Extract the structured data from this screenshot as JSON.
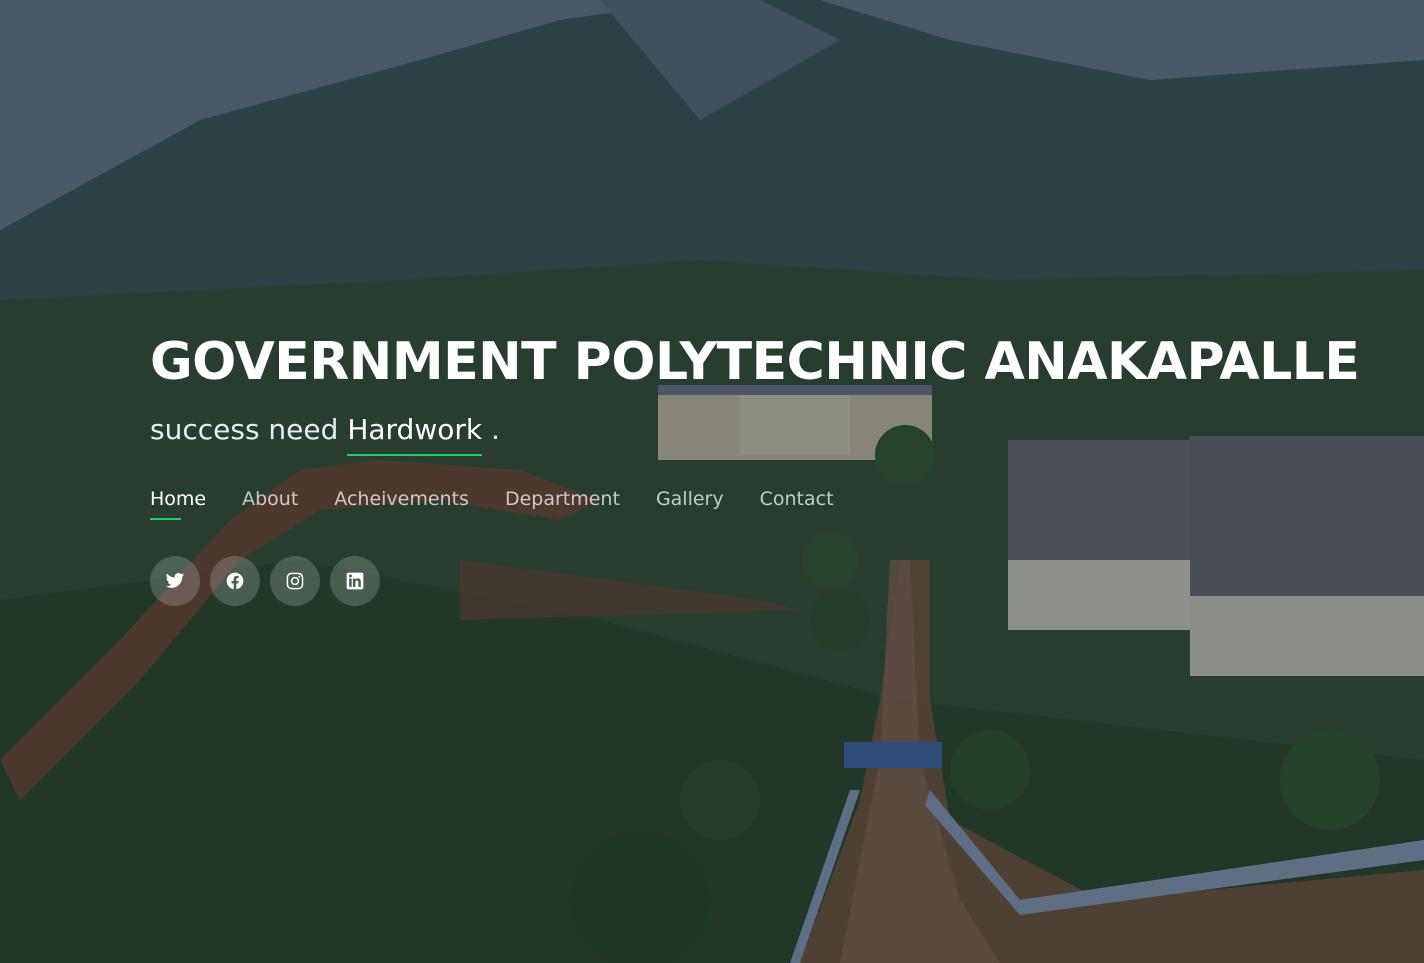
{
  "hero": {
    "title": "GOVERNMENT POLYTECHNIC ANAKAPALLE",
    "tagline_prefix": "success need ",
    "tagline_highlight": "Hardwork",
    "tagline_suffix": " ."
  },
  "nav": {
    "items": [
      {
        "label": "Home",
        "active": true
      },
      {
        "label": "About",
        "active": false
      },
      {
        "label": "Acheivements",
        "active": false
      },
      {
        "label": "Department",
        "active": false
      },
      {
        "label": "Gallery",
        "active": false
      },
      {
        "label": "Contact",
        "active": false
      }
    ]
  },
  "social": {
    "icons": [
      "twitter-icon",
      "facebook-icon",
      "instagram-icon",
      "linkedin-icon"
    ]
  },
  "colors": {
    "accent": "#18d26e",
    "text": "#ffffff"
  }
}
